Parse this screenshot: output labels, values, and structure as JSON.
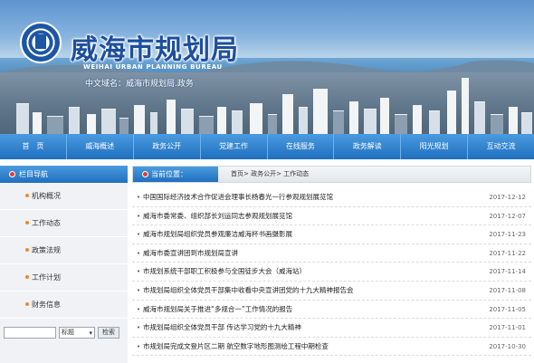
{
  "header": {
    "title_cn": "威海市规划局",
    "title_en": "WEIHAI URBAN PLANNING BUREAU",
    "domain_text": "中文域名：威海市规划局.政务"
  },
  "nav": [
    "首　页",
    "威海概述",
    "政务公开",
    "党建工作",
    "在线服务",
    "政务解读",
    "阳光规划",
    "互动交流"
  ],
  "sidebar": {
    "title": "栏目导航",
    "items": [
      "机构概况",
      "工作动态",
      "政策法规",
      "工作计划",
      "财务信息"
    ]
  },
  "search": {
    "select_value": "标题",
    "button_label": "检索"
  },
  "main": {
    "location_label": "当前位置：",
    "breadcrumb": "首页> 政务公开> 工作动态",
    "news": [
      {
        "title": "中国国际经济技术合作促进会理事长杨春光一行参观规划展览馆",
        "date": "2017-12-12"
      },
      {
        "title": "威海市委常委、组织部长刘运同志参观规划展览馆",
        "date": "2017-12-07"
      },
      {
        "title": "威海市规划局组织党员参观廉洁威海杯书画摄影展",
        "date": "2017-11-23"
      },
      {
        "title": "威海市委宣讲团到市规划局宣讲",
        "date": "2017-11-22"
      },
      {
        "title": "市规划系统干部职工积极参与全国徒步大会（威海站）",
        "date": "2017-11-14"
      },
      {
        "title": "市规划局组织全体党员干部集中收看中央宣讲团党的十九大精神报告会",
        "date": "2017-11-08"
      },
      {
        "title": "威海市规划局关于推进“多规合一”工作情况的报告",
        "date": "2017-11-05"
      },
      {
        "title": "市规划局组织全体党员干部 传达学习党的十九大精神",
        "date": "2017-11-01"
      },
      {
        "title": "市规划局完成文登片区二期 航空数字地形图测绘工程中期检查",
        "date": "2017-10-30"
      }
    ]
  }
}
